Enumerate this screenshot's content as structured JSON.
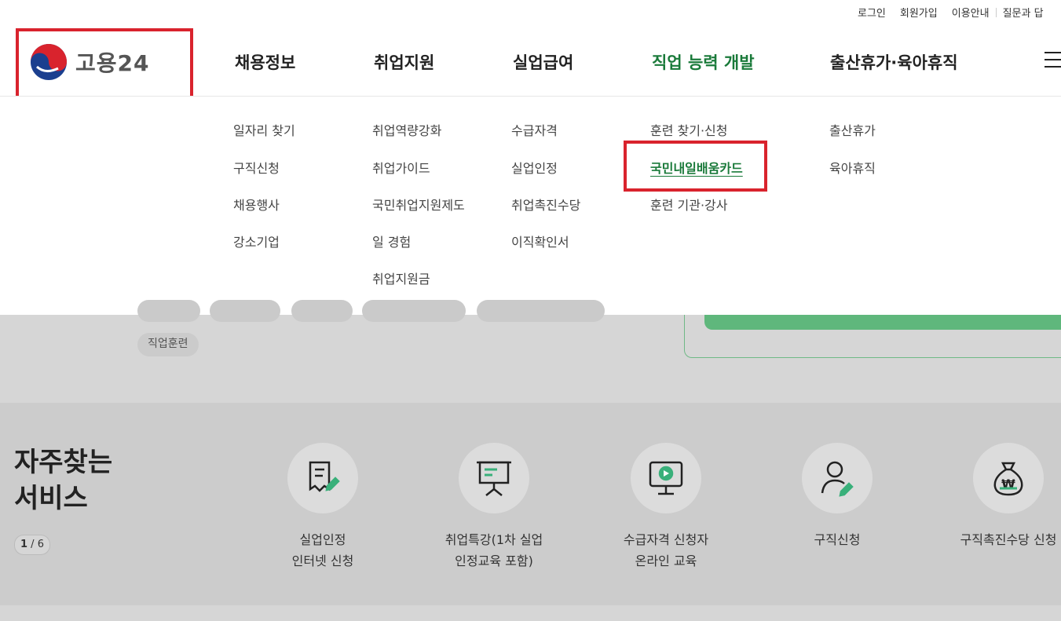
{
  "util_links": [
    "로그인",
    "회원가입",
    "이용안내",
    "질문과 답"
  ],
  "logo": {
    "text": "고용24",
    "icon": "taegeuk-logo-icon"
  },
  "nav": [
    "채용정보",
    "취업지원",
    "실업급여",
    "직업 능력 개발",
    "출산휴가·육아휴직"
  ],
  "dropdown": {
    "col1": [
      "일자리 찾기",
      "구직신청",
      "채용행사",
      "강소기업"
    ],
    "col2": [
      "취업역량강화",
      "취업가이드",
      "국민취업지원제도",
      "일 경험",
      "취업지원금"
    ],
    "col3": [
      "수급자격",
      "실업인정",
      "취업촉진수당",
      "이직확인서"
    ],
    "col4": [
      "훈련 찾기·신청",
      "국민내일배움카드",
      "훈련 기관·강사"
    ],
    "col5": [
      "출산휴가",
      "육아휴직"
    ]
  },
  "tag": "직업훈련",
  "frequent": {
    "title_line1": "자주찾는",
    "title_line2": "서비스",
    "page_current": "1",
    "page_total": "6",
    "items": [
      {
        "label": "실업인정\n인터넷 신청",
        "icon": "document-pen-icon"
      },
      {
        "label": "취업특강(1차 실업\n인정교육 포함)",
        "icon": "presentation-board-icon"
      },
      {
        "label": "수급자격 신청자\n온라인 교육",
        "icon": "monitor-play-icon"
      },
      {
        "label": "구직신청",
        "icon": "person-pen-icon"
      },
      {
        "label": "구직촉진수당 신청",
        "icon": "money-bag-icon"
      }
    ]
  },
  "colors": {
    "accent_green": "#1a7a3a",
    "highlight_red": "#d9232d",
    "bar_green": "#5fb77c"
  }
}
